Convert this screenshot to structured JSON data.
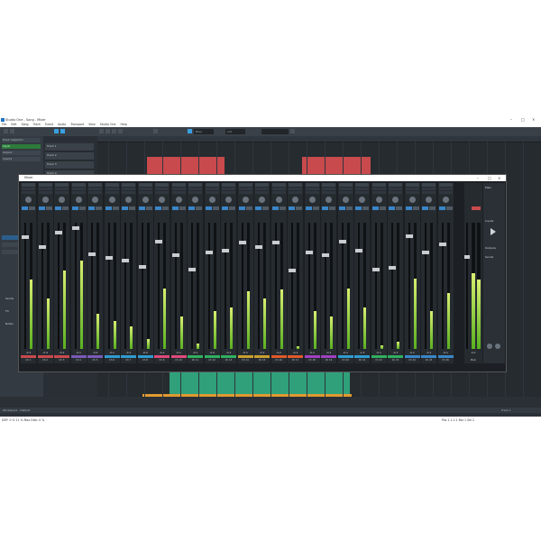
{
  "window": {
    "title": "Studio One - Song - Mixer",
    "minimize_icon": "minimize-icon",
    "maximize_icon": "maximize-icon",
    "close_icon": "close-icon"
  },
  "menu": [
    "File",
    "Edit",
    "Song",
    "Track",
    "Event",
    "Audio",
    "Transport",
    "View",
    "Studio One",
    "Help"
  ],
  "toolbar": {
    "field1": "Bars",
    "field2": "1/4",
    "accent": "#3aa0e0"
  },
  "inspector": {
    "rows": [
      "Track Inspector",
      "Input",
      "Output",
      "Inserts"
    ],
    "sections": [
      "Sends",
      "FX",
      "Notes"
    ]
  },
  "tracks": [
    "Track 1",
    "Track 2",
    "Track 3",
    "Track 4",
    "Track 5",
    "Track 6",
    "Track 7",
    "Track 8",
    "Track 9",
    "Track 10",
    "Track 11",
    "Track 12"
  ],
  "mixer": {
    "title": "Mixer",
    "strips": [
      {
        "value": "-0.1",
        "level": 0.55,
        "color": "#c84a4d",
        "name": "Ch 1"
      },
      {
        "value": "-2.4",
        "level": 0.4,
        "color": "#c84a4d",
        "name": "Ch 2"
      },
      {
        "value": "-0.1",
        "level": 0.62,
        "color": "#c84a4d",
        "name": "Ch 3"
      },
      {
        "value": "-0.1",
        "level": 0.7,
        "color": "#7a5ab8",
        "name": "Ch 4"
      },
      {
        "value": "-3.0",
        "level": 0.28,
        "color": "#7a5ab8",
        "name": "Ch 5"
      },
      {
        "value": "-0.1",
        "level": 0.22,
        "color": "#2f9cd0",
        "name": "Ch 6"
      },
      {
        "value": "-0.1",
        "level": 0.18,
        "color": "#2f9cd0",
        "name": "Ch 7"
      },
      {
        "value": "-6.0",
        "level": 0.08,
        "color": "#2f9cd0",
        "name": "Ch 8"
      },
      {
        "value": "-0.1",
        "level": 0.48,
        "color": "#e04a7a",
        "name": "Ch 9"
      },
      {
        "value": "-0.1",
        "level": 0.26,
        "color": "#e04a7a",
        "name": "Ch 10"
      },
      {
        "value": "-0.1",
        "level": 0.04,
        "color": "#30b060",
        "name": "Ch 11"
      },
      {
        "value": "-2.0",
        "level": 0.3,
        "color": "#30b060",
        "name": "Ch 12"
      },
      {
        "value": "-0.1",
        "level": 0.33,
        "color": "#30b060",
        "name": "Ch 13"
      },
      {
        "value": "-0.1",
        "level": 0.46,
        "color": "#c8a030",
        "name": "Ch 14"
      },
      {
        "value": "-0.1",
        "level": 0.4,
        "color": "#c8a030",
        "name": "Ch 15"
      },
      {
        "value": "-4.2",
        "level": 0.47,
        "color": "#e05a2a",
        "name": "Ch 16"
      },
      {
        "value": "-0.1",
        "level": 0.02,
        "color": "#e05a2a",
        "name": "Ch 17"
      },
      {
        "value": "-0.1",
        "level": 0.3,
        "color": "#a040c0",
        "name": "Ch 18"
      },
      {
        "value": "-0.1",
        "level": 0.26,
        "color": "#a040c0",
        "name": "Ch 19"
      },
      {
        "value": "-0.1",
        "level": 0.48,
        "color": "#2f9cd0",
        "name": "Ch 20"
      },
      {
        "value": "-1.5",
        "level": 0.33,
        "color": "#2f9cd0",
        "name": "Ch 21"
      },
      {
        "value": "-0.1",
        "level": 0.03,
        "color": "#30b060",
        "name": "Ch 22"
      },
      {
        "value": "-0.1",
        "level": 0.06,
        "color": "#30b060",
        "name": "Ch 23"
      },
      {
        "value": "-0.1",
        "level": 0.56,
        "color": "#3a86c8",
        "name": "Ch 24"
      },
      {
        "value": "-0.1",
        "level": 0.3,
        "color": "#3a86c8",
        "name": "Ch 25"
      },
      {
        "value": "-0.1",
        "level": 0.44,
        "color": "#3a86c8",
        "name": "Ch 26"
      }
    ],
    "master": {
      "value": "0.0",
      "level": 0.6,
      "name": "Main"
    },
    "panel": [
      "Main",
      "Inputs",
      "Outputs",
      "Sends"
    ]
  },
  "status": {
    "left": "Workspace  ·  Default",
    "right": "Track 1"
  },
  "infobar": {
    "left": "DSP: 0 %   11 % Max   Disk: 0 %",
    "right": "Pos 1.1.1.1   Bar 1   Sel 2"
  }
}
